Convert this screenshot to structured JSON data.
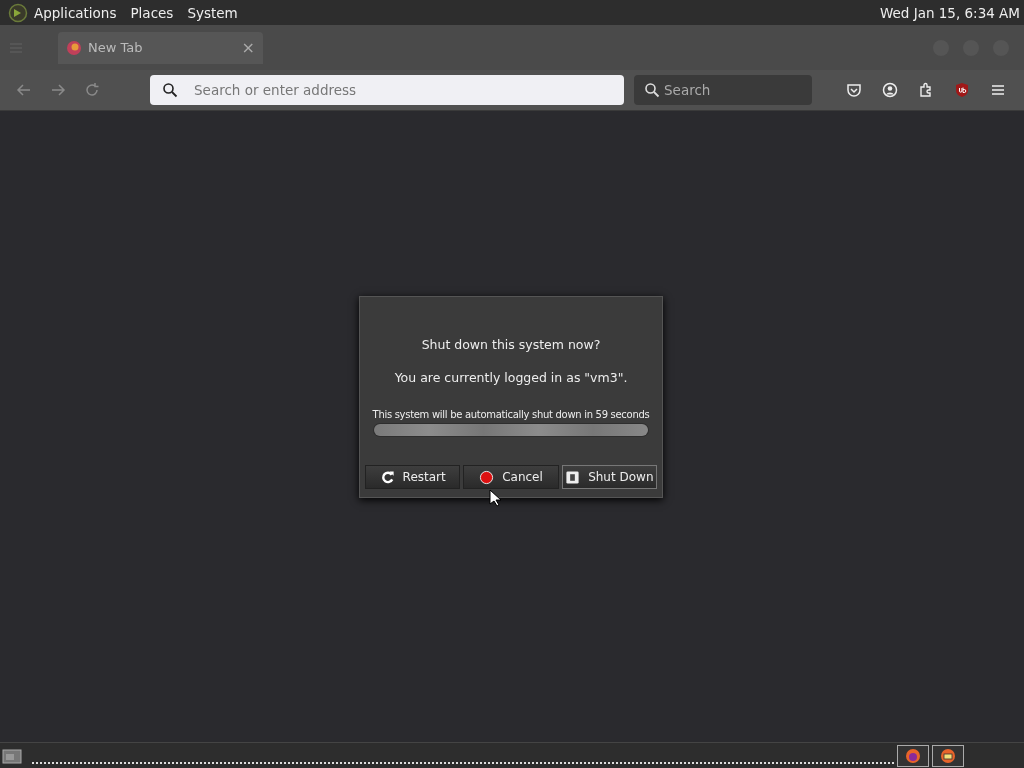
{
  "top_panel": {
    "menus": [
      "Applications",
      "Places",
      "System"
    ],
    "clock": "Wed Jan 15,  6:34 AM"
  },
  "browser": {
    "tabs": [
      {
        "label": "New Tab",
        "close": "×",
        "selected": true
      }
    ],
    "address_bar": {
      "placeholder": "Search or enter address"
    },
    "search_bar": {
      "placeholder": "Search"
    }
  },
  "dialog": {
    "title": "Shut down this system now?",
    "message": "You are currently logged in as \"vm3\".",
    "countdown": "This system will be automatically shut down in 59 seconds",
    "progress": {
      "level": 1
    },
    "buttons": [
      {
        "label": "Restart",
        "kind": "restart",
        "selected": false
      },
      {
        "label": "Cancel",
        "kind": "cancel",
        "selected": false
      },
      {
        "label": "Shut Down",
        "kind": "shutdown",
        "selected": true
      }
    ]
  }
}
